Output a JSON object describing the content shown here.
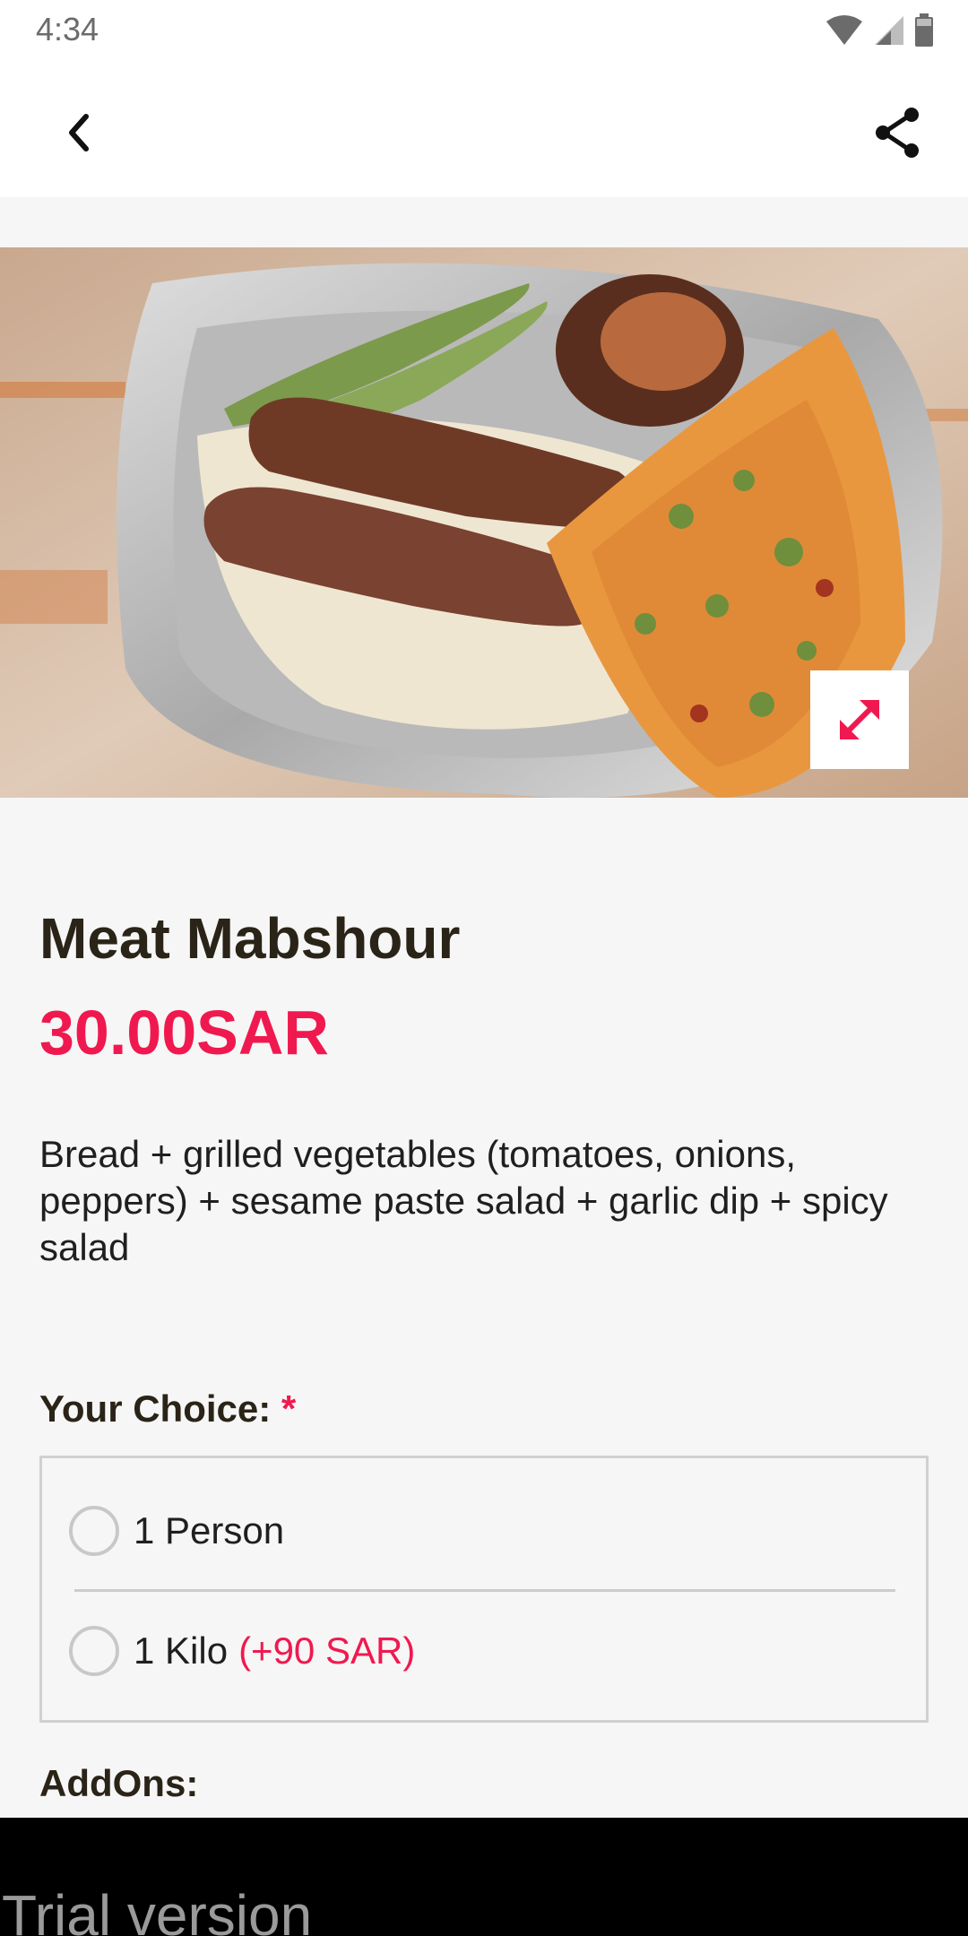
{
  "status_bar": {
    "time": "4:34",
    "icons": [
      "wifi-icon",
      "signal-icon",
      "battery-icon"
    ]
  },
  "app_bar": {
    "back_icon": "chevron-left-icon",
    "share_icon": "share-icon"
  },
  "product": {
    "image_alt": "Meat Mabshour",
    "expand_icon": "expand-icon",
    "title": "Meat Mabshour",
    "price": "30.00SAR",
    "description": "Bread + grilled vegetables (tomatoes, onions, peppers) + sesame paste salad + garlic dip + spicy salad"
  },
  "choice": {
    "heading": "Your Choice:",
    "required_marker": "*",
    "options": [
      {
        "label": "1 Person",
        "extra": "",
        "selected": false
      },
      {
        "label": "1 Kilo",
        "extra": "(+90 SAR)",
        "selected": false
      }
    ]
  },
  "addons": {
    "heading": "AddOns:"
  },
  "trial": {
    "text": "Trial version"
  },
  "colors": {
    "accent": "#f0194f",
    "heading": "#2a2317",
    "background": "#f6f6f6"
  }
}
